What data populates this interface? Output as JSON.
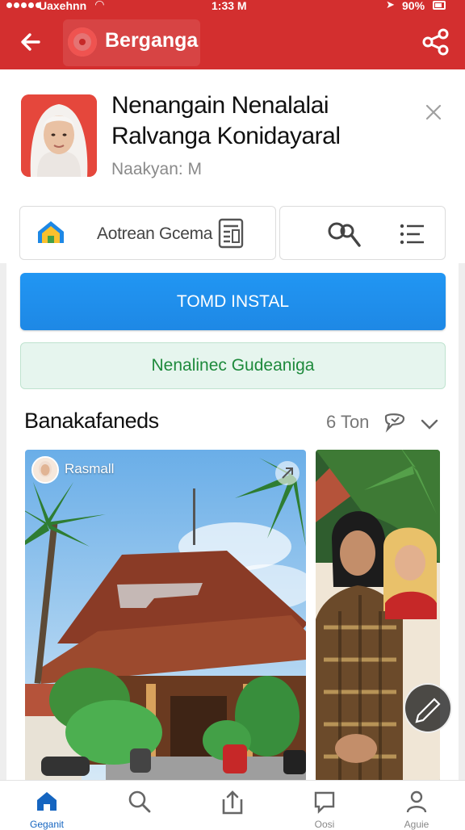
{
  "status_bar": {
    "carrier": "Uaxehnn",
    "time": "1:33 M",
    "battery": "90%"
  },
  "top_bar": {
    "title": "Berganga"
  },
  "app": {
    "name_line1": "Nenangain Nenalalai",
    "name_line2": "Ralvanga Konidayaral",
    "subtitle": "Naakyan: M"
  },
  "actions": {
    "label": "Aotrean Gcema"
  },
  "buttons": {
    "install": "TOMD INSTAL",
    "secondary": "Nenalinec Gudeaniga"
  },
  "section": {
    "title": "Banakafaneds",
    "meta": "6 Ton"
  },
  "photos": [
    {
      "user": "Rasmall"
    },
    {
      "user": ""
    }
  ],
  "bottom_nav": [
    {
      "label": "Geganit",
      "icon": "home-icon"
    },
    {
      "label": "",
      "icon": "search-icon"
    },
    {
      "label": "",
      "icon": "upload-icon"
    },
    {
      "label": "Oosi",
      "icon": "chat-icon"
    },
    {
      "label": "Aguie",
      "icon": "profile-icon"
    }
  ],
  "colors": {
    "app_bar": "#d32f2f",
    "install": "#1e88e5",
    "secondary_text": "#1e8a3c",
    "nav_active": "#1565c0"
  }
}
